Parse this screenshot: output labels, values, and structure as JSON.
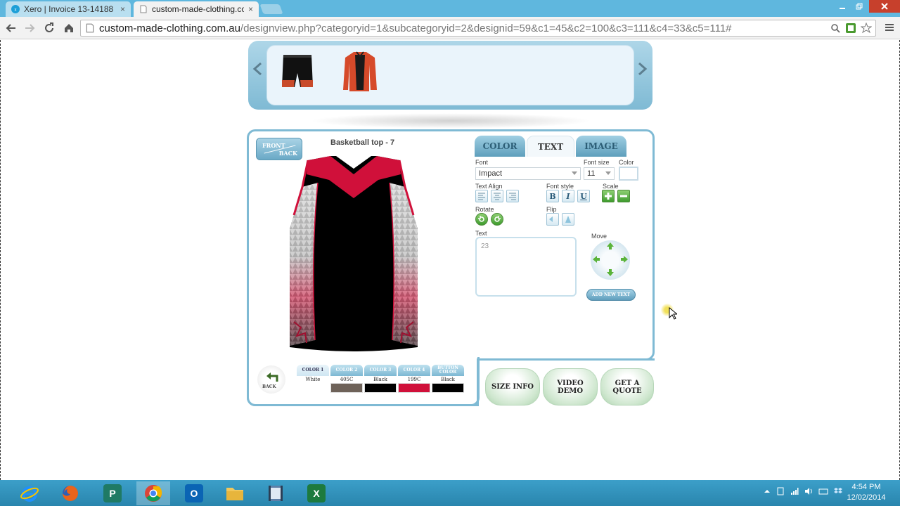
{
  "browser": {
    "tabs": [
      {
        "title": "Xero | Invoice 13-14188",
        "active": false
      },
      {
        "title": "custom-made-clothing.co",
        "active": true
      }
    ],
    "close_glyph": "×",
    "url_host": "custom-made-clothing.com.au",
    "url_rest": "/designview.php?categoryid=1&subcategoryid=2&designid=59&c1=45&c2=100&c3=111&c4=33&c5=111#",
    "icons": [
      "back-icon",
      "forward-icon",
      "reload-icon",
      "home-icon",
      "page-icon",
      "search-icon",
      "extension-icon",
      "star-icon",
      "menu-icon"
    ]
  },
  "designer": {
    "title": "Basketball top - 7",
    "front_back": {
      "front": "FRONT",
      "back": "BACK"
    },
    "tabs": {
      "color": "COLOR",
      "text": "TEXT",
      "image": "IMAGE"
    },
    "active_tab": "TEXT",
    "font_label": "Font",
    "font_value": "Impact",
    "font_size_label": "Font size",
    "font_size_value": "11",
    "color_label": "Color",
    "text_align_label": "Text Align",
    "font_style_label": "Font style",
    "font_style": {
      "bold": "B",
      "italic": "I",
      "underline": "U"
    },
    "scale_label": "Scale",
    "rotate_label": "Rotate",
    "flip_label": "Flip",
    "text_label": "Text",
    "text_value": "23",
    "move_label": "Move",
    "add_text_button": "ADD NEW TEXT",
    "back_button": "BACK",
    "swatches": [
      {
        "head": "COLOR 1",
        "name": "White",
        "color": "#ffffff"
      },
      {
        "head": "COLOR 2",
        "name": "405C",
        "color": "#6e6259"
      },
      {
        "head": "COLOR 3",
        "name": "Black",
        "color": "#000000"
      },
      {
        "head": "COLOR 4",
        "name": "199C",
        "color": "#d0103a"
      },
      {
        "head": "BUTTON COLOR",
        "name": "Black",
        "color": "#000000"
      }
    ],
    "actions": {
      "size_info": "SIZE INFO",
      "video_demo": "VIDEO DEMO",
      "get_quote": "GET A QUOTE"
    }
  },
  "colors": {
    "panel_border": "#7fbad4",
    "jersey_red": "#d0103a",
    "taskbar": "#2985ad"
  },
  "taskbar": {
    "apps": [
      "internet-explorer-icon",
      "firefox-icon",
      "publisher-icon",
      "chrome-icon",
      "outlook-icon",
      "file-explorer-icon",
      "media-icon",
      "excel-icon"
    ],
    "time": "4:54 PM",
    "date": "12/02/2014"
  }
}
